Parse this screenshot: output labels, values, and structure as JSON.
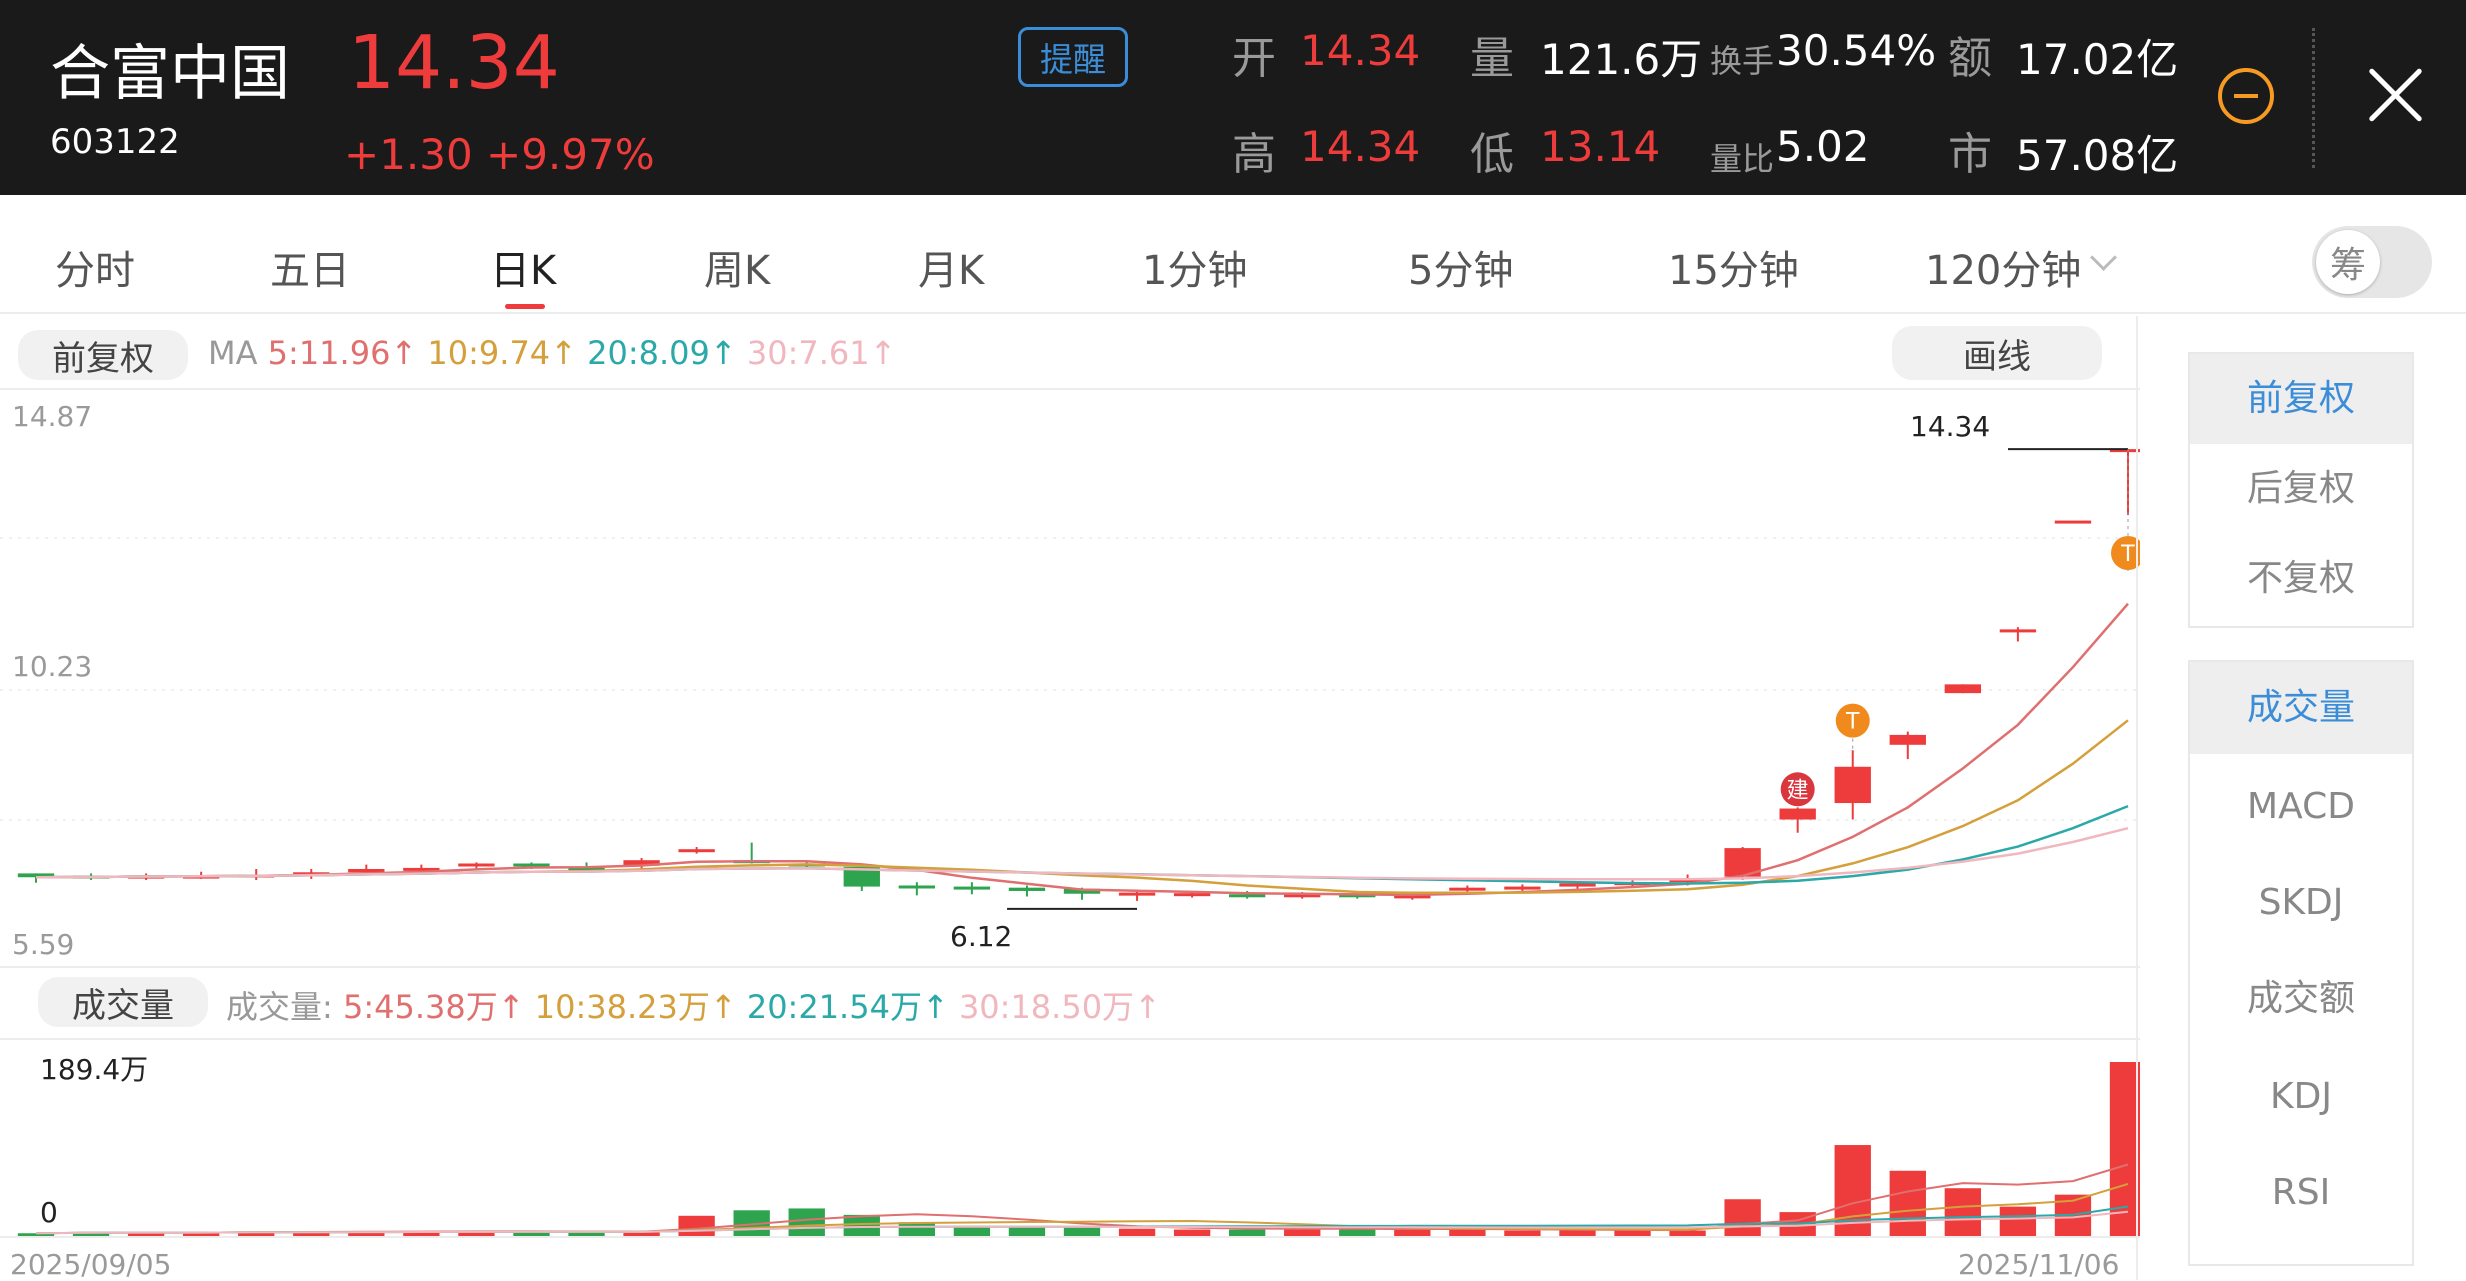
{
  "header": {
    "stock_name": "合富中国",
    "stock_code": "603122",
    "price": "14.34",
    "change": "+1.30",
    "change_pct": "+9.97%",
    "alert_label": "提醒",
    "stats": {
      "open_label": "开",
      "open_value": "14.34",
      "volume_label": "量",
      "volume_value": "121.6万",
      "turnover_label": "换手",
      "turnover_value": "30.54%",
      "amount_label": "额",
      "amount_value": "17.02亿",
      "high_label": "高",
      "high_value": "14.34",
      "low_label": "低",
      "low_value": "13.14",
      "vol_ratio_label": "量比",
      "vol_ratio_value": "5.02",
      "mcap_label": "市",
      "mcap_value": "57.08亿"
    }
  },
  "tabs": [
    "分时",
    "五日",
    "日K",
    "周K",
    "月K",
    "1分钟",
    "5分钟",
    "15分钟",
    "120分钟"
  ],
  "active_tab": "日K",
  "chip_toggle_label": "筹",
  "price_panel": {
    "adjust_pill": "前复权",
    "ma_label": "MA",
    "ma5": "5:11.96",
    "ma10": "10:9.74",
    "ma20": "20:8.09",
    "ma30": "30:7.61",
    "arrow": "↑",
    "draw_button": "画线",
    "y_top": "14.87",
    "y_mid": "10.23",
    "y_bottom": "5.59",
    "low_marker": "6.12",
    "high_marker": "14.34",
    "marker_build": "建",
    "marker_t": "T"
  },
  "volume_panel": {
    "pill": "成交量",
    "label": "成交量:",
    "ma5": "5:45.38万",
    "ma10": "10:38.23万",
    "ma20": "20:21.54万",
    "ma30": "30:18.50万",
    "arrow": "↑",
    "y_top": "189.4万",
    "y_zero": "0",
    "date_start": "2025/09/05",
    "date_end": "2025/11/06"
  },
  "colors": {
    "up": "#ee3b3b",
    "down": "#2ea44f",
    "ma5": "#e06f6f",
    "ma10": "#d4a03c",
    "ma20": "#2ba8a8",
    "ma30": "#f0b7be",
    "accent": "#3c8dd8"
  },
  "side_menu_adjust": [
    "前复权",
    "后复权",
    "不复权"
  ],
  "side_menu_indicators": [
    "成交量",
    "MACD",
    "SKDJ",
    "成交额",
    "KDJ",
    "RSI"
  ],
  "chart_data": {
    "type": "candlestick",
    "x_range": [
      "2025/09/05",
      "2025/11/06"
    ],
    "ylim": [
      5.59,
      14.87
    ],
    "candles": [
      {
        "o": 6.62,
        "h": 6.62,
        "l": 6.45,
        "c": 6.55
      },
      {
        "o": 6.58,
        "h": 6.62,
        "l": 6.5,
        "c": 6.56
      },
      {
        "o": 6.56,
        "h": 6.62,
        "l": 6.5,
        "c": 6.58
      },
      {
        "o": 6.58,
        "h": 6.65,
        "l": 6.52,
        "c": 6.58
      },
      {
        "o": 6.58,
        "h": 6.7,
        "l": 6.5,
        "c": 6.6
      },
      {
        "o": 6.58,
        "h": 6.7,
        "l": 6.52,
        "c": 6.64
      },
      {
        "o": 6.64,
        "h": 6.78,
        "l": 6.6,
        "c": 6.7
      },
      {
        "o": 6.7,
        "h": 6.78,
        "l": 6.62,
        "c": 6.72
      },
      {
        "o": 6.76,
        "h": 6.82,
        "l": 6.7,
        "c": 6.8
      },
      {
        "o": 6.8,
        "h": 6.82,
        "l": 6.7,
        "c": 6.78
      },
      {
        "o": 6.72,
        "h": 6.82,
        "l": 6.64,
        "c": 6.66
      },
      {
        "o": 6.76,
        "h": 6.9,
        "l": 6.7,
        "c": 6.86
      },
      {
        "o": 7.03,
        "h": 7.1,
        "l": 6.98,
        "c": 7.06
      },
      {
        "o": 6.86,
        "h": 7.18,
        "l": 6.8,
        "c": 6.84
      },
      {
        "o": 6.8,
        "h": 6.86,
        "l": 6.72,
        "c": 6.78
      },
      {
        "o": 6.74,
        "h": 6.78,
        "l": 6.3,
        "c": 6.38
      },
      {
        "o": 6.4,
        "h": 6.46,
        "l": 6.22,
        "c": 6.36
      },
      {
        "o": 6.38,
        "h": 6.46,
        "l": 6.24,
        "c": 6.34
      },
      {
        "o": 6.36,
        "h": 6.4,
        "l": 6.2,
        "c": 6.3
      },
      {
        "o": 6.34,
        "h": 6.36,
        "l": 6.14,
        "c": 6.25
      },
      {
        "o": 6.24,
        "h": 6.32,
        "l": 6.12,
        "c": 6.27
      },
      {
        "o": 6.22,
        "h": 6.3,
        "l": 6.18,
        "c": 6.26
      },
      {
        "o": 6.24,
        "h": 6.3,
        "l": 6.16,
        "c": 6.22
      },
      {
        "o": 6.22,
        "h": 6.28,
        "l": 6.16,
        "c": 6.24
      },
      {
        "o": 6.24,
        "h": 6.28,
        "l": 6.16,
        "c": 6.2
      },
      {
        "o": 6.2,
        "h": 6.26,
        "l": 6.14,
        "c": 6.22
      },
      {
        "o": 6.32,
        "h": 6.4,
        "l": 6.28,
        "c": 6.36
      },
      {
        "o": 6.36,
        "h": 6.42,
        "l": 6.3,
        "c": 6.38
      },
      {
        "o": 6.38,
        "h": 6.46,
        "l": 6.34,
        "c": 6.44
      },
      {
        "o": 6.42,
        "h": 6.5,
        "l": 6.38,
        "c": 6.46
      },
      {
        "o": 6.46,
        "h": 6.6,
        "l": 6.4,
        "c": 6.52
      },
      {
        "o": 6.56,
        "h": 7.1,
        "l": 6.5,
        "c": 7.08
      },
      {
        "o": 7.6,
        "h": 7.82,
        "l": 7.36,
        "c": 7.8
      },
      {
        "o": 7.9,
        "h": 8.86,
        "l": 7.6,
        "c": 8.56
      },
      {
        "o": 8.96,
        "h": 9.2,
        "l": 8.7,
        "c": 9.14
      },
      {
        "o": 9.9,
        "h": 10.06,
        "l": 9.9,
        "c": 10.06
      },
      {
        "o": 11.06,
        "h": 11.1,
        "l": 10.84,
        "c": 11.06
      },
      {
        "o": 13.04,
        "h": 13.04,
        "l": 13.04,
        "c": 13.04
      },
      {
        "o": 14.34,
        "h": 14.34,
        "l": 13.14,
        "c": 14.34
      }
    ],
    "volumes": [
      3,
      4,
      4,
      4,
      5,
      5,
      5,
      5,
      5,
      5,
      4,
      4,
      22,
      28,
      30,
      23,
      15,
      11,
      10,
      9,
      8,
      7,
      7,
      8,
      9,
      7,
      7,
      6,
      6,
      7,
      6,
      40,
      26,
      99,
      71,
      52,
      32,
      45,
      189.4
    ],
    "volume_ylim": [
      0,
      189.4
    ]
  }
}
